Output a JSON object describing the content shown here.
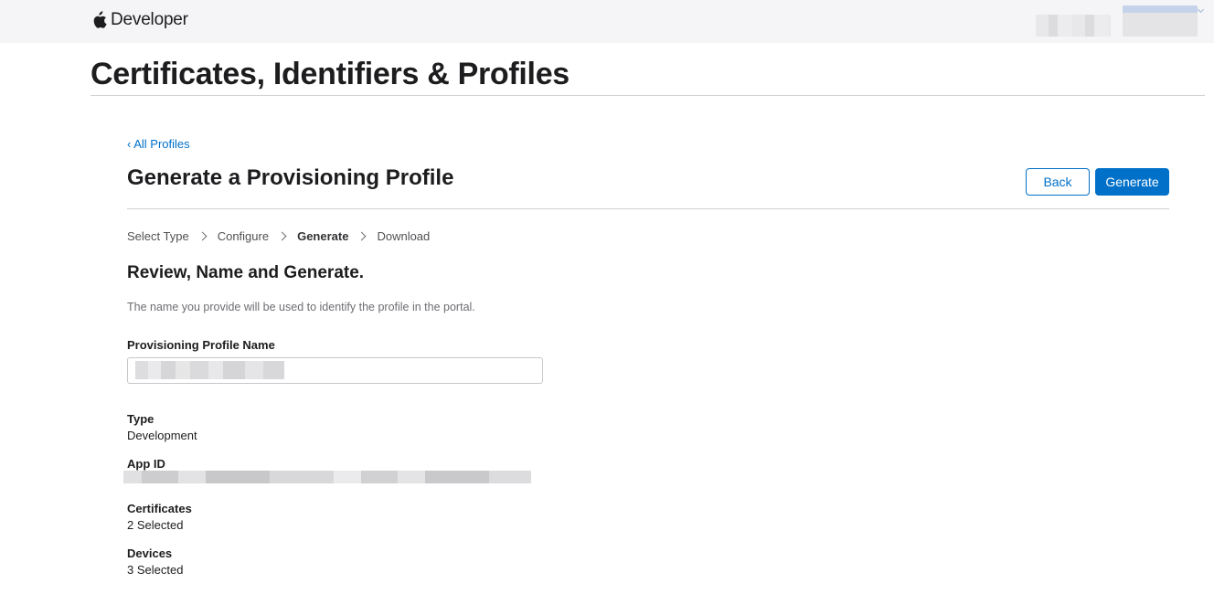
{
  "header": {
    "brand": "Developer",
    "logo_icon": "apple-logo-icon"
  },
  "main": {
    "title": "Certificates, Identifiers & Profiles"
  },
  "page": {
    "back_link": "‹ All Profiles",
    "heading": "Generate a Provisioning Profile",
    "buttons": {
      "back": "Back",
      "generate": "Generate"
    },
    "steps": [
      {
        "label": "Select Type",
        "current": false
      },
      {
        "label": "Configure",
        "current": false
      },
      {
        "label": "Generate",
        "current": true
      },
      {
        "label": "Download",
        "current": false
      }
    ],
    "section_heading": "Review, Name and Generate.",
    "description": "The name you provide will be used to identify the profile in the portal.",
    "fields": {
      "profile_name_label": "Provisioning Profile Name",
      "profile_name_value": "",
      "type_label": "Type",
      "type_value": "Development",
      "app_id_label": "App ID",
      "certificates_label": "Certificates",
      "certificates_value": "2 Selected",
      "devices_label": "Devices",
      "devices_value": "3 Selected"
    }
  },
  "colors": {
    "accent": "#0070c9",
    "topbar_bg": "#f5f5f7",
    "divider": "#d2d2d7"
  }
}
